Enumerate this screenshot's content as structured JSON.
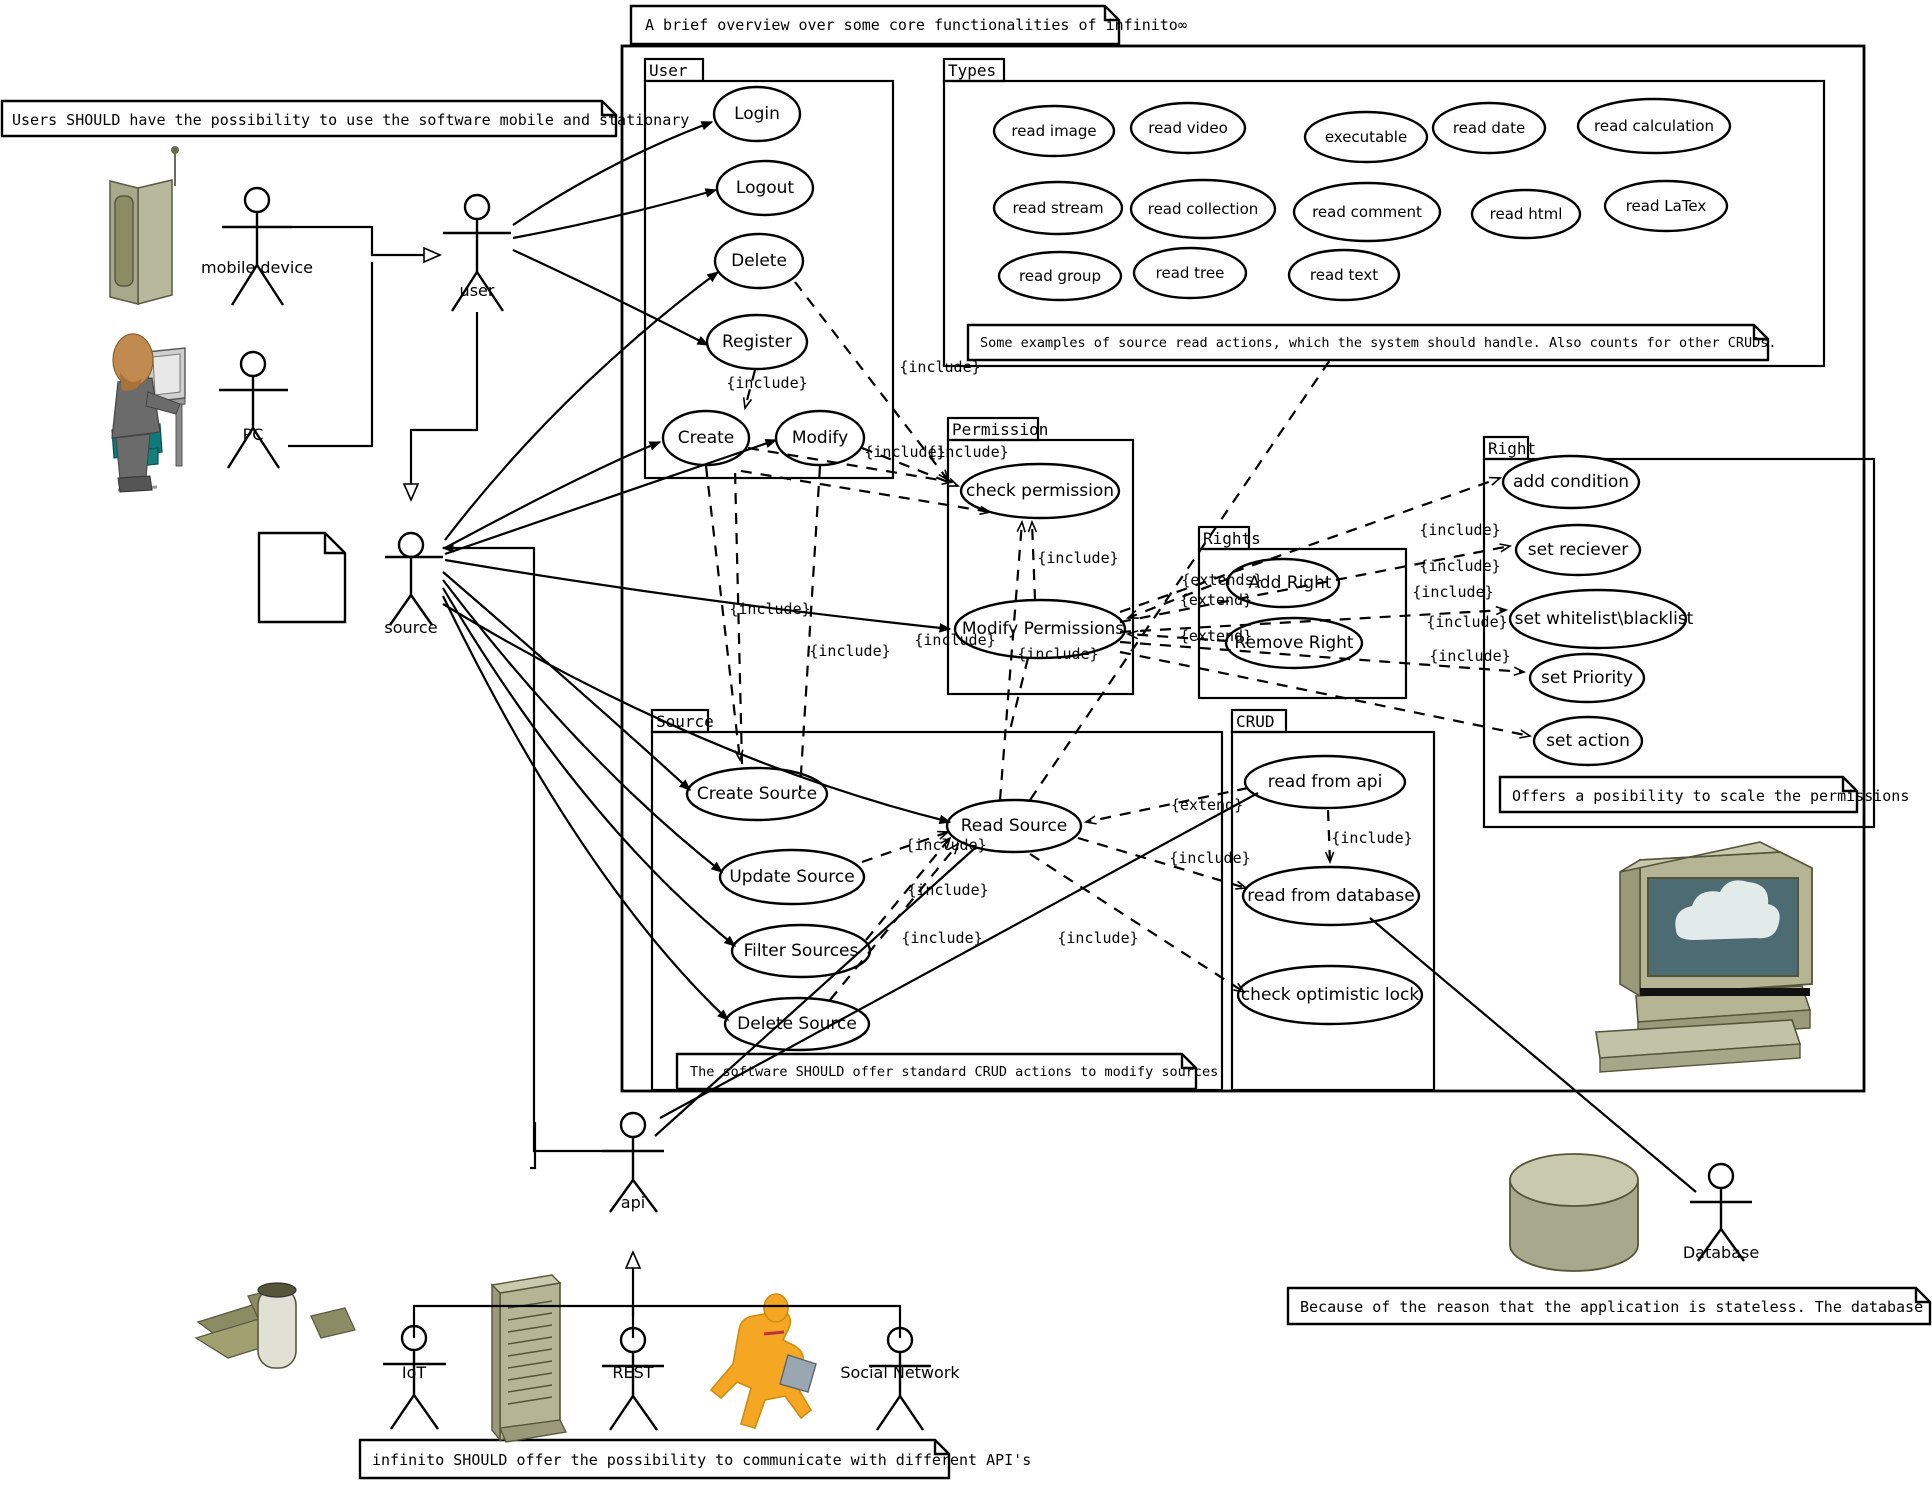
{
  "diagram": {
    "title_note": "A brief overview over some core functionalities of infinito∞",
    "notes": {
      "mobile": "Users SHOULD have the possibility to use the software mobile and stationary",
      "types": "Some examples of source read actions, which the system should handle. Also counts for other CRUDs.",
      "right": "Offers a posibility to scale the permissions",
      "source": "The software SHOULD offer standard CRUD actions to modify sources",
      "api": "infinito SHOULD offer the possibility to communicate with different API's",
      "database": "Because of the reason that the application is stateless. The database is a actor"
    },
    "packages": {
      "user": {
        "name": "User",
        "use_cases": [
          "Login",
          "Logout",
          "Delete",
          "Register",
          "Create",
          "Modify"
        ]
      },
      "types": {
        "name": "Types",
        "use_cases": [
          "read image",
          "read video",
          "executable",
          "read date",
          "read calculation",
          "read stream",
          "read collection",
          "read comment",
          "read html",
          "read LaTex",
          "read group",
          "read tree",
          "read text"
        ]
      },
      "permission": {
        "name": "Permission",
        "use_cases": [
          "check permission",
          "Modify Permissions"
        ]
      },
      "rights": {
        "name": "Rights",
        "use_cases": [
          "Add Right",
          "Remove Right"
        ]
      },
      "right": {
        "name": "Right",
        "use_cases": [
          "add condition",
          "set reciever",
          "set whitelist\\blacklist",
          "set Priority",
          "set action"
        ]
      },
      "source": {
        "name": "Source",
        "use_cases": [
          "Create Source",
          "Update Source",
          "Filter Sources",
          "Delete Source",
          "Read Source"
        ]
      },
      "crud": {
        "name": "CRUD",
        "use_cases": [
          "read from api",
          "read from database",
          "check optimistic lock"
        ]
      }
    },
    "actors": [
      {
        "name": "mobile device"
      },
      {
        "name": "PC"
      },
      {
        "name": "user"
      },
      {
        "name": "source"
      },
      {
        "name": "api"
      },
      {
        "name": "IoT"
      },
      {
        "name": "REST"
      },
      {
        "name": "Social Network"
      },
      {
        "name": "Database"
      }
    ],
    "stereotypes": {
      "include": "{include}",
      "extend": "{extend}",
      "extends": "{extends}"
    },
    "colors": {
      "line": "#000000",
      "fill": "#ffffff",
      "device_body": "#a8a88c",
      "device_light": "#c3c3a8",
      "device_dark": "#8c8c70",
      "screen": "#4d6b73",
      "cloud": "#e2eaea",
      "person_hair": "#c08a50",
      "person_shirt": "#6b6b6b",
      "person_chair": "#0e7a7a",
      "runner": "#f5a623"
    }
  }
}
